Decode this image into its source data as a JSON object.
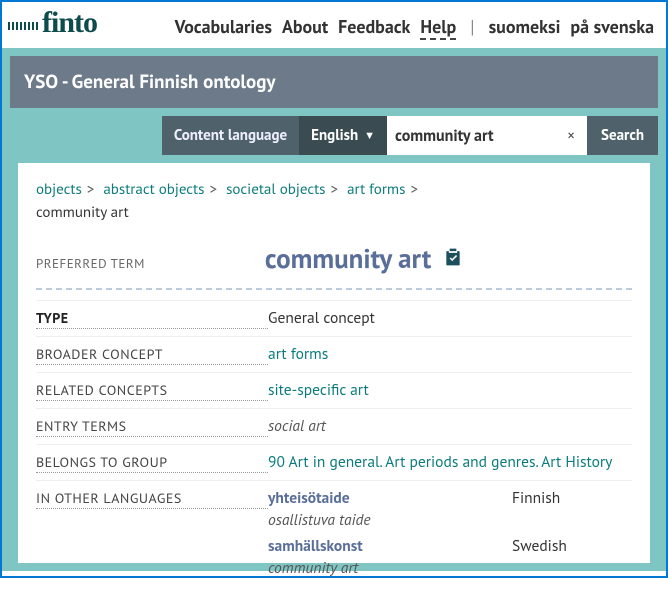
{
  "nav": {
    "vocabularies": "Vocabularies",
    "about": "About",
    "feedback": "Feedback",
    "help": "Help",
    "fi": "suomeksi",
    "sv": "på svenska"
  },
  "vocab": {
    "title": "YSO - General Finnish ontology"
  },
  "search": {
    "content_lang_label": "Content language",
    "lang_selected": "English",
    "query": "community art",
    "button": "Search",
    "clear": "×"
  },
  "breadcrumb": {
    "items": [
      "objects",
      "abstract objects",
      "societal objects",
      "art forms"
    ],
    "current": "community art"
  },
  "pref": {
    "label": "PREFERRED TERM",
    "term": "community art"
  },
  "props": {
    "type": {
      "label": "TYPE",
      "value": "General concept"
    },
    "broader": {
      "label": "BROADER CONCEPT",
      "value": "art forms"
    },
    "related": {
      "label": "RELATED CONCEPTS",
      "value": "site-specific art"
    },
    "entry": {
      "label": "ENTRY TERMS",
      "value": "social art"
    },
    "group": {
      "label": "BELONGS TO GROUP",
      "value": "90 Art in general. Art periods and genres. Art History"
    },
    "other": {
      "label": "IN OTHER LANGUAGES"
    }
  },
  "otherlang": {
    "fi": {
      "term": "yhteisötaide",
      "alt": "osallistuva taide",
      "lang": "Finnish"
    },
    "sv": {
      "term": "samhällskonst",
      "alt": "community art",
      "lang": "Swedish"
    }
  }
}
